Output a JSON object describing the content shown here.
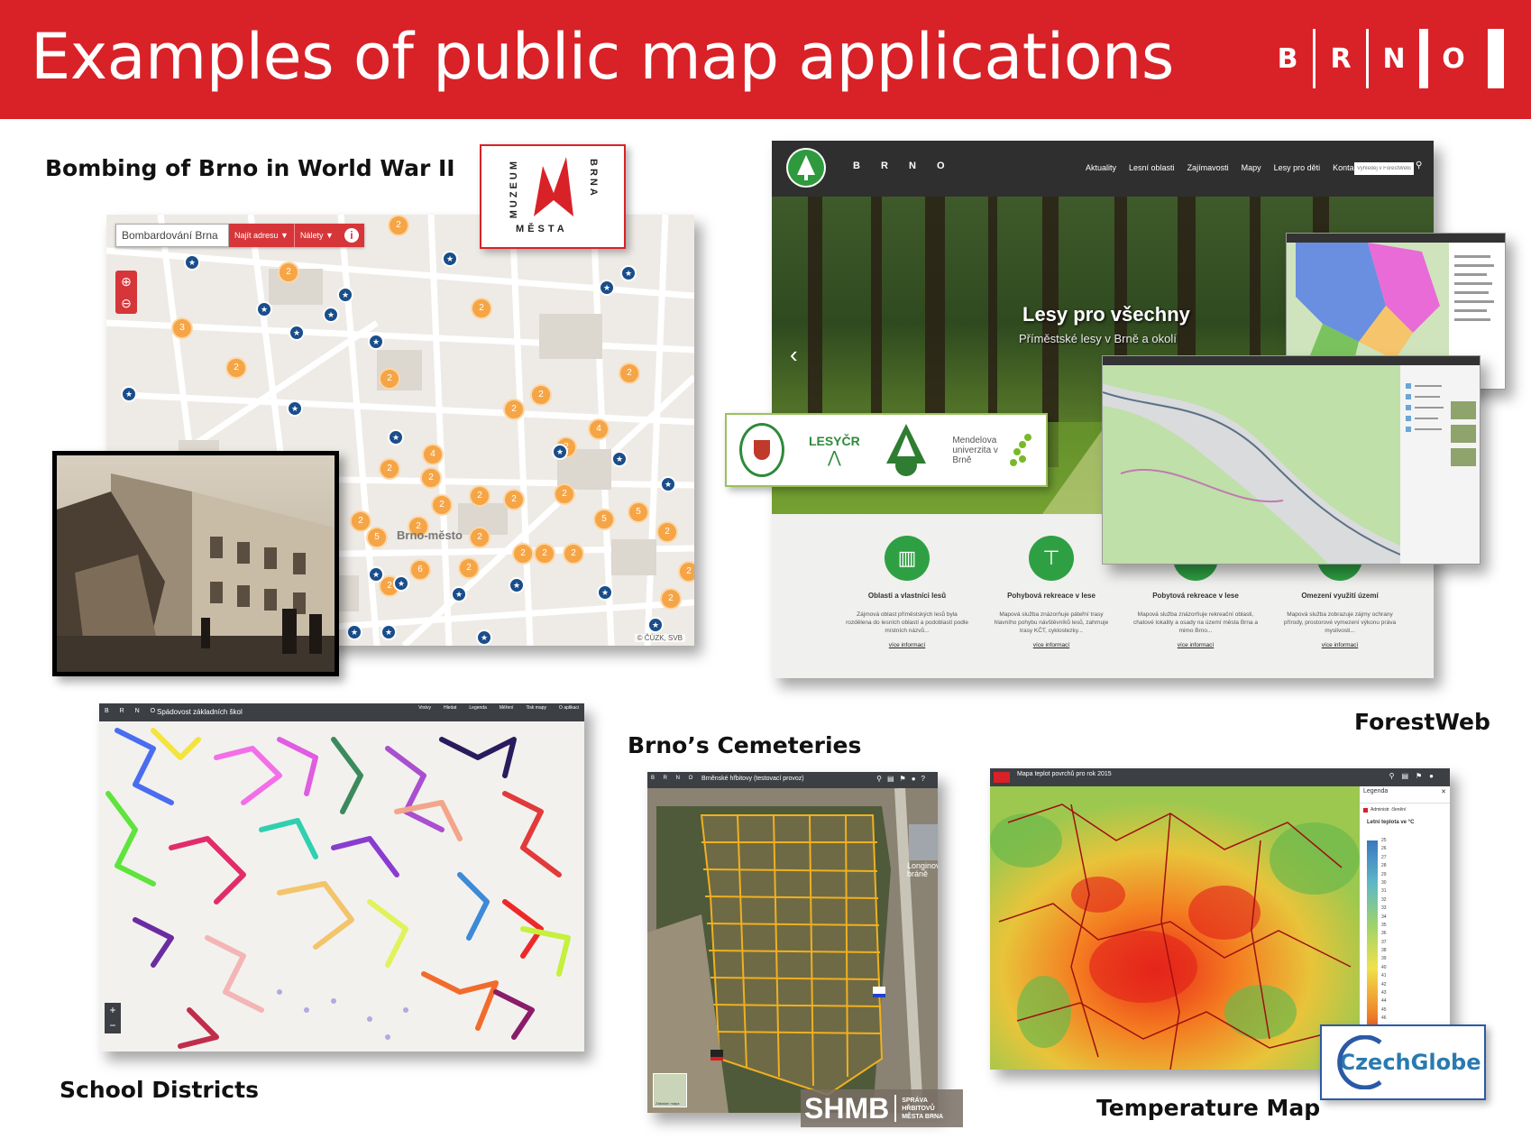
{
  "slide": {
    "title": "Examples of public map applications",
    "logo_letters": [
      "B",
      "R",
      "N",
      "O"
    ],
    "accent_color": "#d92128"
  },
  "bombing": {
    "caption": "Bombing of Brno in World War II",
    "search_value": "Bombardování Brna",
    "find_address_label": "Najít adresu ▼",
    "raids_label": "Nálety ▼",
    "district_label": "Brno-město",
    "attribution": "© ČÚZK, SVB",
    "museum_logo": [
      "MUZEUM",
      "MĚSTA",
      "BRNA"
    ]
  },
  "forestweb": {
    "caption": "ForestWeb",
    "nav": [
      "Aktuality",
      "Lesní oblasti",
      "Zajímavosti",
      "Mapy",
      "Lesy pro děti",
      "Kontakt"
    ],
    "search_placeholder": "Vyhledej v ForestWebu",
    "hero_title": "Lesy pro všechny",
    "hero_subtitle": "Příměstské lesy v Brně a okolí",
    "partners": [
      "LESYČR",
      "Mendelova univerzita v Brně"
    ],
    "features": [
      {
        "title": "Oblasti a vlastníci lesů",
        "text": "Zájmová oblast příměstských lesů byla rozdělena do lesních oblastí a podoblastí podle místních názvů...",
        "link": "více informací"
      },
      {
        "title": "Pohybová rekreace v lese",
        "text": "Mapová služba znázorňuje páteřní trasy hlavního pohybu návštěvníků lesů, zahrnuje trasy KČT, cyklostezky...",
        "link": "více informací"
      },
      {
        "title": "Pobytová rekreace v lese",
        "text": "Mapová služba znázorňuje rekreační oblasti, chatové lokality a osady na území města Brna a mimo Brno...",
        "link": "více informací"
      },
      {
        "title": "Omezení využití území",
        "text": "Mapová služba zobrazuje zájmy ochrany přírody, prostorové vymezení výkonu práva myslivosti...",
        "link": "více informací"
      }
    ]
  },
  "school": {
    "caption": "School Districts",
    "app_title": "Spádovost základních škol",
    "toolbar": [
      "Vrstvy",
      "Hledat",
      "Legenda",
      "Měření",
      "Tisk mapy",
      "O aplikaci"
    ]
  },
  "cemetery": {
    "caption": "Brno’s Cemeteries",
    "app_title": "Brněnské hřbitovy (testovací provoz)",
    "label": "Longinova bráně",
    "shmb": "SHMB",
    "shmb_sub": [
      "SPRÁVA",
      "HŘBITOVŮ",
      "MĚSTA BRNA"
    ],
    "basemap_label": "Základní mapa"
  },
  "temperature": {
    "caption": "Temperature Map",
    "app_title": "Mapa teplot povrchů pro rok 2015",
    "legend_title": "Legenda",
    "legend_item": "Administr. členění",
    "legend_sub": "Letní teplota ve °C",
    "scale_ticks": [
      "25",
      "26",
      "27",
      "28",
      "29",
      "30",
      "31",
      "32",
      "33",
      "34",
      "35",
      "36",
      "37",
      "38",
      "39",
      "40",
      "41",
      "42",
      "43",
      "44",
      "45",
      "46",
      "47",
      "48",
      "49",
      "50"
    ],
    "partner": "CzechGlobe"
  }
}
